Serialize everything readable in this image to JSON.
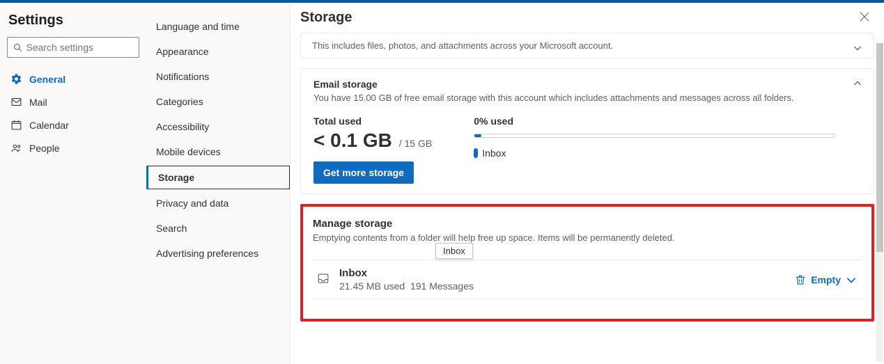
{
  "header": {
    "title": "Settings"
  },
  "search": {
    "placeholder": "Search settings"
  },
  "nav": {
    "general": "General",
    "mail": "Mail",
    "calendar": "Calendar",
    "people": "People"
  },
  "subnav": {
    "items": [
      "Language and time",
      "Appearance",
      "Notifications",
      "Categories",
      "Accessibility",
      "Mobile devices",
      "Storage",
      "Privacy and data",
      "Search",
      "Advertising preferences"
    ]
  },
  "page": {
    "title": "Storage"
  },
  "account_card": {
    "desc": "This includes files, photos, and attachments across your Microsoft account."
  },
  "email_card": {
    "title": "Email storage",
    "desc": "You have 15.00 GB of free email storage with this account which includes attachments and messages across all folders.",
    "total_label": "Total used",
    "used_value": "< 0.1 GB",
    "cap": "/ 15 GB",
    "button": "Get more storage",
    "pct": "0% used",
    "legend": "Inbox"
  },
  "manage": {
    "title": "Manage storage",
    "desc": "Emptying contents from a folder will help free up space. Items will be permanently deleted.",
    "tooltip": "Inbox",
    "folder": {
      "name": "Inbox",
      "size": "21.45 MB used",
      "count": "191 Messages"
    },
    "empty_label": "Empty"
  }
}
